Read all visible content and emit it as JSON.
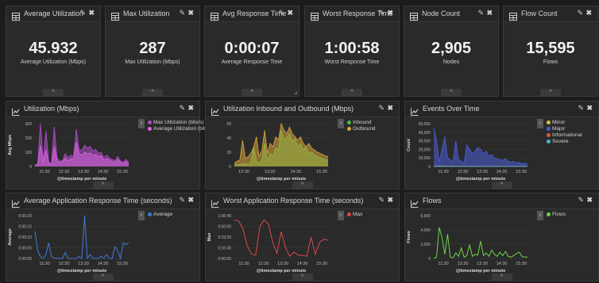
{
  "stats": [
    {
      "title": "Average Utilization",
      "value": "45.932",
      "subtitle": "Average Utilization (Mbps)"
    },
    {
      "title": "Max Utilization",
      "value": "287",
      "subtitle": "Max Utilization (Mbps)"
    },
    {
      "title": "Avg Response Time",
      "value": "0:00:07",
      "subtitle": "Average Response Time"
    },
    {
      "title": "Worst Response Time",
      "value": "1:00:58",
      "subtitle": "Worst Response Time"
    },
    {
      "title": "Node Count",
      "value": "2,905",
      "subtitle": "Nodes"
    },
    {
      "title": "Flow Count",
      "value": "15,595",
      "subtitle": "Flows"
    }
  ],
  "ui": {
    "edit_glyph": "✎",
    "close_glyph": "✖",
    "expand_glyph": "^",
    "legend_toggle_glyph": "›",
    "chart_icon": "line-chart-icon",
    "table_icon": "table-icon"
  },
  "charts": [
    {
      "title": "Utilization (Mbps)",
      "chart_data": {
        "type": "area",
        "xlabel": "@timestamp per minute",
        "ylabel": "Avg Mbps",
        "x_ticks": [
          "11:30",
          "12:30",
          "13:30",
          "14:30",
          "15:30"
        ],
        "y_ticks": [
          "0",
          "100",
          "200",
          "300"
        ],
        "ylim": [
          0,
          300
        ],
        "series": [
          {
            "name": "Max Utilization (bits/s)",
            "color": "#b04ec9",
            "values": [
              10,
              20,
              300,
              40,
              250,
              30,
              20,
              280,
              60,
              40,
              40,
              90,
              60,
              80,
              70,
              260,
              120,
              110,
              150,
              130,
              140,
              110,
              120,
              90,
              100,
              60,
              80,
              60,
              50,
              40,
              70,
              40,
              30,
              50,
              30
            ]
          },
          {
            "name": "Average Utilization (bit...",
            "color": "#d866e0",
            "values": [
              5,
              10,
              150,
              30,
              120,
              20,
              15,
              140,
              40,
              30,
              30,
              60,
              40,
              55,
              50,
              170,
              90,
              80,
              100,
              90,
              95,
              80,
              85,
              70,
              75,
              45,
              55,
              45,
              35,
              30,
              50,
              30,
              20,
              35,
              20
            ]
          }
        ]
      }
    },
    {
      "title": "Utilization Inbound and Outbound (Mbps)",
      "chart_data": {
        "type": "area",
        "xlabel": "@timestamp per minute",
        "ylabel": "",
        "x_ticks": [
          "12:30",
          "13:30",
          "14:30",
          "15:30"
        ],
        "y_ticks": [
          "0",
          "20",
          "40",
          "60"
        ],
        "ylim": [
          0,
          65
        ],
        "series": [
          {
            "name": "Inbound",
            "color": "#47c447",
            "values": [
              2,
              3,
              3,
              4,
              5,
              3,
              6,
              30,
              8,
              5,
              10,
              35,
              8,
              20,
              15,
              28,
              25,
              55,
              40,
              45,
              50,
              38,
              42,
              30,
              35,
              25,
              30,
              20,
              22,
              18,
              15,
              14,
              12,
              10,
              10
            ]
          },
          {
            "name": "Outbound",
            "color": "#d9a63c",
            "values": [
              5,
              8,
              10,
              40,
              12,
              15,
              20,
              30,
              45,
              15,
              25,
              55,
              20,
              35,
              30,
              45,
              40,
              65,
              55,
              50,
              60,
              50,
              45,
              40,
              45,
              35,
              30,
              35,
              28,
              25,
              22,
              20,
              18,
              16,
              15
            ]
          }
        ]
      }
    },
    {
      "title": "Events Over Time",
      "chart_data": {
        "type": "area",
        "xlabel": "@timestamp per minute",
        "ylabel": "Count",
        "x_ticks": [
          "11:30",
          "12:30",
          "13:30",
          "14:30",
          "15:30"
        ],
        "y_ticks": [
          "0",
          "10,000",
          "20,000",
          "30,000",
          "40,000",
          "50,000"
        ],
        "ylim": [
          0,
          50000
        ],
        "series": [
          {
            "name": "Minor",
            "color": "#d9c43c",
            "values": [
              500,
              500,
              800,
              600,
              500,
              400,
              400,
              500,
              400,
              400,
              400,
              300,
              300,
              400,
              300,
              300,
              300,
              200,
              200,
              200,
              200,
              200,
              200,
              200,
              200,
              200,
              200,
              200,
              200,
              200,
              200,
              200,
              200,
              200,
              200
            ]
          },
          {
            "name": "Major",
            "color": "#4a5ed8",
            "values": [
              45000,
              30000,
              5000,
              20000,
              35000,
              10000,
              8000,
              5000,
              30000,
              8000,
              6000,
              4000,
              25000,
              20000,
              15000,
              18000,
              22000,
              20000,
              15000,
              18000,
              12000,
              14000,
              10000,
              9000,
              8000,
              7000,
              9000,
              6000,
              5000,
              6000,
              4000,
              5000,
              3000,
              4000,
              3000
            ]
          },
          {
            "name": "Informational",
            "color": "#d85a3c",
            "values": [
              0,
              0,
              0,
              0,
              0,
              0,
              0,
              0,
              0,
              0,
              0,
              0,
              0,
              0,
              0,
              0,
              0,
              0,
              0,
              0,
              0,
              0,
              0,
              0,
              0,
              0,
              0,
              0,
              0,
              0,
              0,
              0,
              0,
              0,
              0
            ]
          },
          {
            "name": "Severe",
            "color": "#4ab0d8",
            "values": [
              0,
              0,
              0,
              0,
              0,
              0,
              0,
              0,
              0,
              0,
              0,
              0,
              0,
              0,
              0,
              0,
              0,
              0,
              0,
              0,
              0,
              0,
              0,
              0,
              0,
              0,
              0,
              0,
              0,
              0,
              0,
              0,
              0,
              0,
              0
            ]
          }
        ]
      }
    },
    {
      "title": "Average Application Response Time (seconds)",
      "chart_data": {
        "type": "line",
        "xlabel": "@timestamp per minute",
        "ylabel": "Average",
        "x_ticks": [
          "11:30",
          "12:30",
          "13:30",
          "14:30",
          "15:30"
        ],
        "y_ticks": [
          "0:00:00",
          "0:00:05",
          "0:00:10",
          "0:00:15",
          "0:00:20"
        ],
        "ylim": [
          0,
          22
        ],
        "series": [
          {
            "name": "Average",
            "color": "#3f7bd8",
            "values": [
              14,
              4,
              1,
              0,
              2,
              8,
              1,
              0,
              0,
              0,
              0,
              3,
              0,
              0,
              0,
              0,
              1,
              0,
              22,
              0,
              2,
              0,
              0,
              0,
              1,
              0,
              2,
              0,
              0,
              6,
              4,
              0,
              8,
              7,
              8
            ]
          }
        ]
      }
    },
    {
      "title": "Worst Application Response Time (seconds)",
      "chart_data": {
        "type": "line",
        "xlabel": "@timestamp per minute",
        "ylabel": "Max",
        "x_ticks": [
          "11:30",
          "12:30",
          "13:30",
          "14:30",
          "15:30"
        ],
        "y_ticks": [
          "0:00:00",
          "0:16:40",
          "0:33:20",
          "0:50:00",
          "1:06:40"
        ],
        "ylim": [
          0,
          4000
        ],
        "series": [
          {
            "name": "Max",
            "color": "#d94a4a",
            "values": [
              3600,
              3500,
              2800,
              1200,
              400,
              300,
              3000,
              3600,
              3200,
              1500,
              500,
              2500,
              1000,
              200,
              600,
              300,
              300,
              200,
              2000,
              400,
              1500,
              1800,
              1700
            ]
          }
        ]
      }
    },
    {
      "title": "Flows",
      "chart_data": {
        "type": "line",
        "xlabel": "@timestamp per minute",
        "ylabel": "Flows",
        "x_ticks": [
          "11:30",
          "12:30",
          "13:30",
          "14:30",
          "15:30"
        ],
        "y_ticks": [
          "0",
          "2,000",
          "4,000",
          "6,000"
        ],
        "ylim": [
          0,
          6200
        ],
        "series": [
          {
            "name": "Flows",
            "color": "#6fd44a",
            "values": [
              0,
              200,
              4500,
              3000,
              600,
              3500,
              200,
              100,
              800,
              300,
              1500,
              200,
              400,
              2000,
              300,
              600,
              500,
              2500,
              400,
              800,
              300,
              1200,
              600,
              300,
              900,
              400,
              1000,
              300,
              200,
              400,
              700,
              900,
              300,
              200,
              200
            ]
          }
        ]
      }
    }
  ]
}
